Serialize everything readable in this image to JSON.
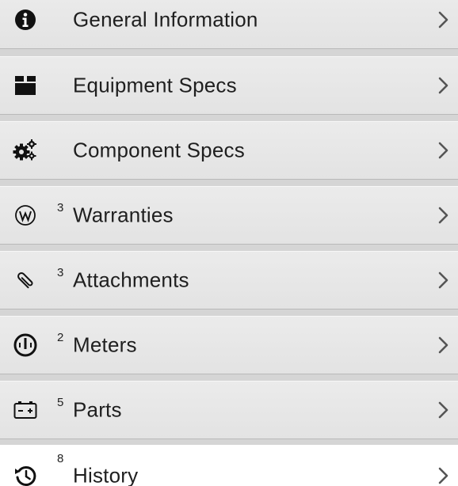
{
  "menu": {
    "items": [
      {
        "label": "General Information",
        "badge": "",
        "icon": "info-icon"
      },
      {
        "label": "Equipment Specs",
        "badge": "",
        "icon": "equipment-box-icon"
      },
      {
        "label": "Component Specs",
        "badge": "",
        "icon": "gears-icon"
      },
      {
        "label": "Warranties",
        "badge": "3",
        "icon": "warranty-w-icon"
      },
      {
        "label": "Attachments",
        "badge": "3",
        "icon": "paperclip-icon"
      },
      {
        "label": "Meters",
        "badge": "2",
        "icon": "gauge-icon"
      },
      {
        "label": "Parts",
        "badge": "5",
        "icon": "battery-icon"
      },
      {
        "label": "History",
        "badge": "8",
        "icon": "history-clock-icon"
      }
    ],
    "active_item": "History"
  },
  "colors": {
    "row_background": "#e6e6e6",
    "active_background": "#ffffff",
    "divider": "#b9b9b9",
    "text": "#1f1f1f",
    "chevron": "#555555"
  }
}
